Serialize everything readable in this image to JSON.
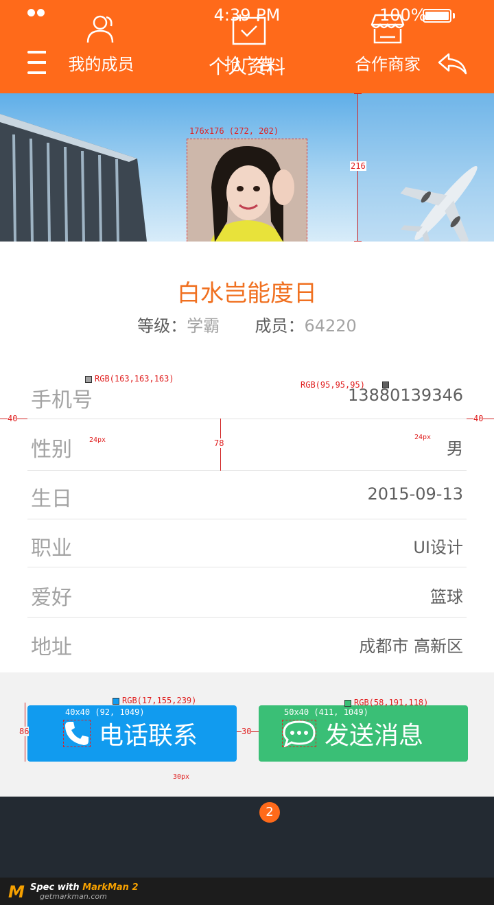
{
  "status_bar": {
    "time": "4:39 PM",
    "battery": "100%"
  },
  "nav": {
    "title": "个人资料"
  },
  "profile": {
    "nickname": "白水岂能度日",
    "level_label": "等级：",
    "level_value": "学霸",
    "members_label": "成员：",
    "members_value": "64220"
  },
  "info_rows": [
    {
      "label": "手机号",
      "value": "13880139346"
    },
    {
      "label": "性别",
      "value": "男"
    },
    {
      "label": "生日",
      "value": "2015-09-13"
    },
    {
      "label": "职业",
      "value": "UI设计"
    },
    {
      "label": "爱好",
      "value": "篮球"
    },
    {
      "label": "地址",
      "value": "成都市 高新区"
    }
  ],
  "actions": {
    "call": "电话联系",
    "message": "发送消息"
  },
  "tabbar": {
    "tabs": [
      {
        "label": "我的成员"
      },
      {
        "label": "抢广告",
        "badge": "2"
      },
      {
        "label": "合作商家"
      }
    ]
  },
  "colors": {
    "primary": "#ff6a1a",
    "call": "#119bef",
    "message": "#3abf76",
    "tabbar": "#232a32"
  },
  "watermark": {
    "spec_with": "Spec with",
    "brand": "MarkMan 2",
    "url": "getmarkman.com"
  },
  "annotations": {
    "avatar_spec": "176x176 (272, 202)",
    "banner_height": "216",
    "color_label": "RGB(163,163,163)",
    "color_value": "RGB(95,95,95)",
    "margin_left": "40",
    "margin_right": "40",
    "row_height": "78",
    "font_left": "24px",
    "font_right": "24px",
    "btn_height": "86",
    "btn_gap": "30",
    "call_color": "RGB(17,155,239)",
    "msg_color": "RGB(58,191,118)",
    "call_icon_spec": "40x40 (92, 1049)",
    "msg_icon_spec": "50x40 (411, 1049)",
    "btn_font": "30px"
  }
}
